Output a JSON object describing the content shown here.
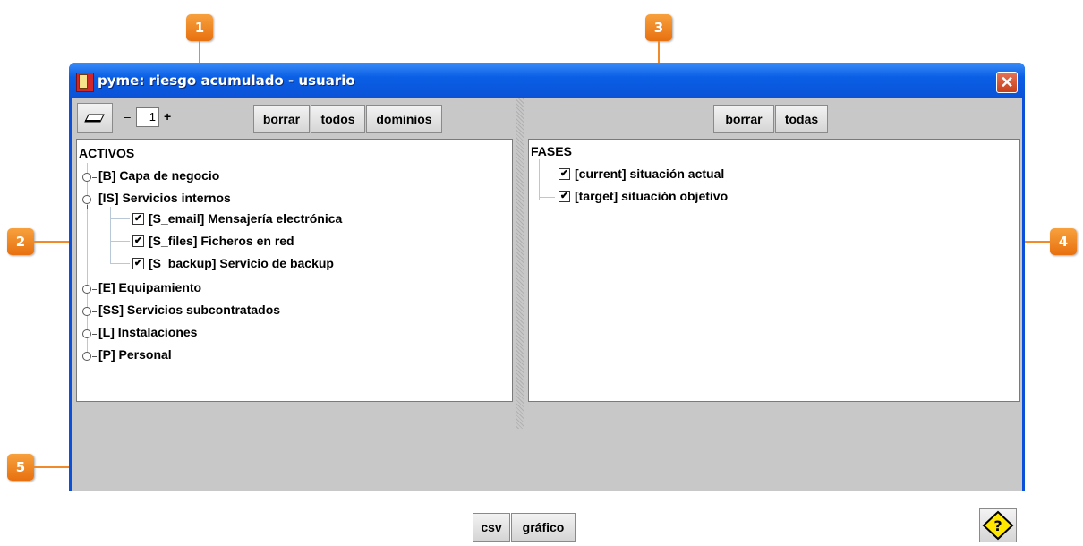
{
  "window": {
    "title": "pyme: riesgo acumulado - usuario"
  },
  "left_toolbar": {
    "level_minus": "–",
    "level_value": "1",
    "level_plus": "+",
    "borrar": "borrar",
    "todos": "todos",
    "dominios": "dominios"
  },
  "right_toolbar": {
    "borrar": "borrar",
    "todas": "todas"
  },
  "activos_tree": {
    "root": "ACTIVOS",
    "items": [
      {
        "label": "[B] Capa de negocio"
      },
      {
        "label": "[IS] Servicios internos"
      },
      {
        "label": "[S_email] Mensajería electrónica"
      },
      {
        "label": "[S_files] Ficheros en red"
      },
      {
        "label": "[S_backup] Servicio de backup"
      },
      {
        "label": "[E] Equipamiento"
      },
      {
        "label": "[SS] Servicios subcontratados"
      },
      {
        "label": "[L] Instalaciones"
      },
      {
        "label": "[P] Personal"
      }
    ]
  },
  "fases_tree": {
    "root": "FASES",
    "items": [
      {
        "label": "[current] situación actual"
      },
      {
        "label": "[target] situación objetivo"
      }
    ]
  },
  "bottom": {
    "csv": "csv",
    "grafico": "gráfico"
  },
  "callouts": [
    "1",
    "2",
    "3",
    "4",
    "5"
  ],
  "icons": {
    "eraser": "eraser-icon",
    "help": "help-icon",
    "close": "close-icon",
    "check": "✔"
  },
  "colors": {
    "accent": "#f08a2a",
    "titlebar": "#0a5fe5",
    "help_yellow": "#ffe600"
  }
}
